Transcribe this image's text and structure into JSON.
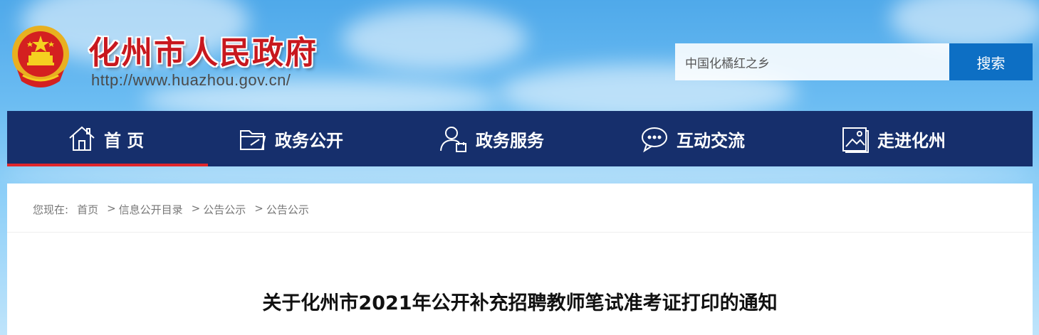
{
  "header": {
    "site_title": "化州市人民政府",
    "site_url": "http://www.huazhou.gov.cn/"
  },
  "search": {
    "value": "中国化橘红之乡",
    "button_label": "搜索"
  },
  "nav": {
    "items": [
      {
        "label": "首 页",
        "icon": "home-icon"
      },
      {
        "label": "政务公开",
        "icon": "folder-icon"
      },
      {
        "label": "政务服务",
        "icon": "user-service-icon"
      },
      {
        "label": "互动交流",
        "icon": "chat-icon"
      },
      {
        "label": "走进化州",
        "icon": "picture-icon"
      }
    ]
  },
  "breadcrumb": {
    "prefix": "您现在:",
    "items": [
      "首页",
      "信息公开目录",
      "公告公示",
      "公告公示"
    ],
    "separator": ">"
  },
  "article": {
    "title": "关于化州市2021年公开补充招聘教师笔试准考证打印的通知"
  },
  "colors": {
    "nav_bg": "#162f6c",
    "active_bar": "#e0262b",
    "search_button": "#0d6fc4",
    "title_red": "#c8181e"
  }
}
